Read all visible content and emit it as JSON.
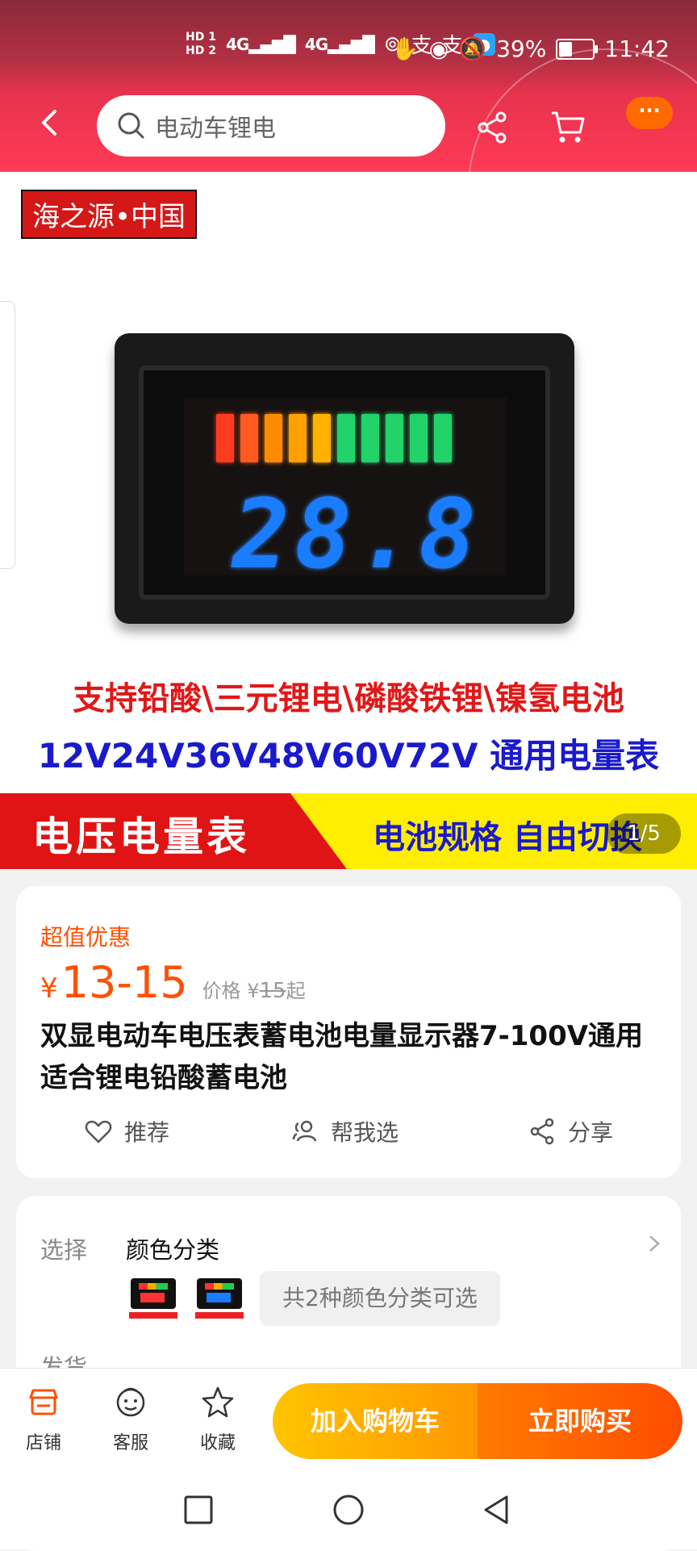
{
  "status_bar": {
    "hd1": "HD 1",
    "hd2": "HD 2",
    "net1": "4G",
    "net2": "4G",
    "battery_percent": "39%",
    "battery_level": 0.39,
    "time": "11:42"
  },
  "header": {
    "search_text": "电动车锂电",
    "more_label": "···"
  },
  "hero": {
    "brand_tag": "海之源•中国",
    "display_digits": "28.8",
    "line1": "支持铅酸\\三元锂电\\磷酸铁锂\\镍氢电池",
    "line2": "12V24V36V48V60V72V 通用电量表",
    "banner_left": "电压电量表",
    "banner_right": "电池规格  自由切换",
    "image_counter": "1/5",
    "bar_colors": [
      "#ff3b1f",
      "#ff5a1f",
      "#ff8a00",
      "#ffa000",
      "#ffb000",
      "#22d36a",
      "#22d36a",
      "#22d36a",
      "#22d36a",
      "#22d36a"
    ]
  },
  "price_card": {
    "promo_label": "超值优惠",
    "currency": "¥",
    "price": "13-15",
    "orig_label": "价格",
    "orig_currency": "¥",
    "orig_price": "15",
    "orig_suffix": "起",
    "title": "双显电动车电压表蓄电池电量显示器7-100V通用适合锂电铅酸蓄电池",
    "actions": {
      "recommend": "推荐",
      "help_choose": "帮我选",
      "share": "分享"
    }
  },
  "sku_card": {
    "label": "选择",
    "value": "颜色分类",
    "more": "共2种颜色分类可选",
    "next_row_label": "发货"
  },
  "bottom_bar": {
    "shop": "店铺",
    "service": "客服",
    "favorite": "收藏",
    "add_to_cart": "加入购物车",
    "buy_now": "立即购买"
  },
  "colors": {
    "accent_orange": "#ff5000",
    "header_red": "#ff3a55"
  }
}
